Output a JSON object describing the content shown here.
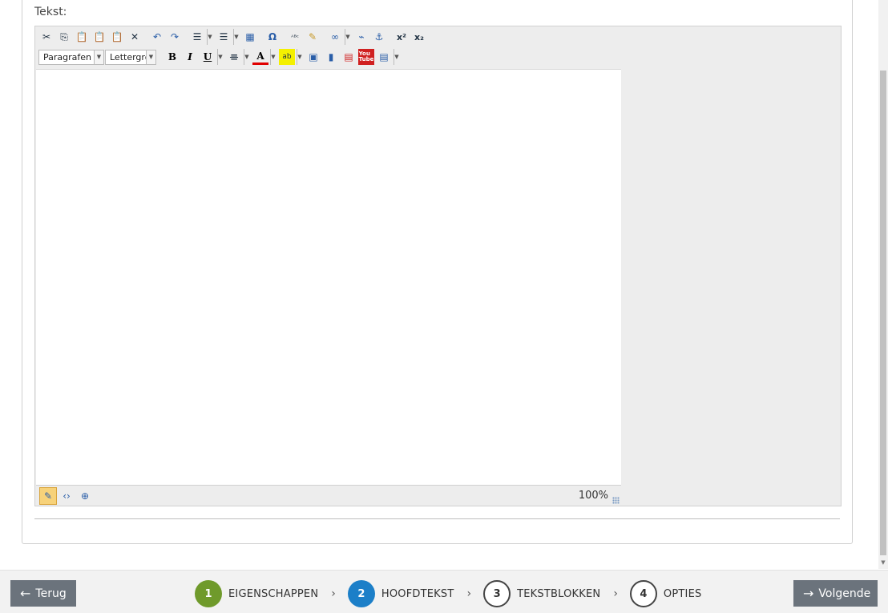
{
  "field": {
    "label": "Tekst:"
  },
  "editor": {
    "toolbar1": [
      "cut-icon",
      "copy-icon",
      "paste-icon",
      "paste-text-icon",
      "paste-word-icon",
      "remove-format-icon",
      "undo-icon",
      "redo-icon",
      "ordered-list-icon",
      "unordered-list-icon",
      "table-icon",
      "special-char-icon",
      "spellcheck-icon",
      "format-painter-icon",
      "link-icon",
      "unlink-icon",
      "anchor-icon",
      "superscript-icon",
      "subscript-icon"
    ],
    "paragraph_select": "Paragrafen",
    "font_select": "Lettergrootte",
    "bold": "B",
    "italic": "I",
    "underline": "U",
    "zoom": "100%"
  },
  "footer": {
    "back_label": "Terug",
    "next_label": "Volgende",
    "steps": [
      {
        "num": "1",
        "label": "EIGENSCHAPPEN",
        "state": "done"
      },
      {
        "num": "2",
        "label": "HOOFDTEKST",
        "state": "current"
      },
      {
        "num": "3",
        "label": "TEKSTBLOKKEN",
        "state": "todo"
      },
      {
        "num": "4",
        "label": "OPTIES",
        "state": "todo"
      }
    ]
  },
  "colors": {
    "done": "#6f9a2b",
    "current": "#1c7fc8",
    "button": "#6b737c"
  }
}
